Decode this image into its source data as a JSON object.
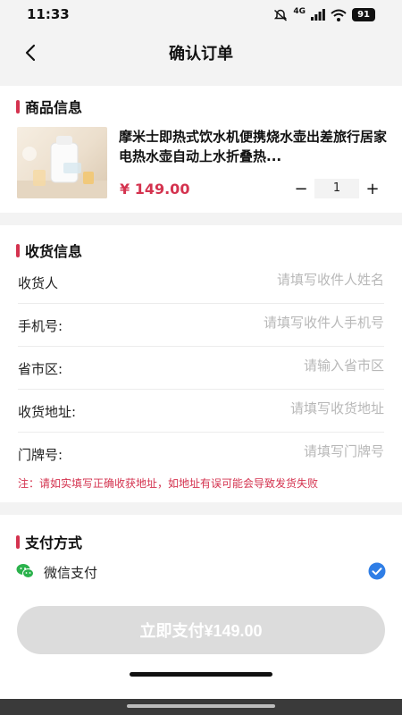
{
  "status_bar": {
    "time": "11:33",
    "network": "4G",
    "battery": "91"
  },
  "nav": {
    "title": "确认订单"
  },
  "product_section": {
    "title": "商品信息",
    "product": {
      "name": "摩米士即热式饮水机便携烧水壶出差旅行居家电热水壶自动上水折叠热...",
      "price": "¥ 149.00",
      "quantity": "1",
      "decrement": "−",
      "increment": "+"
    }
  },
  "shipping_section": {
    "title": "收货信息",
    "fields": [
      {
        "label": "收货人",
        "value": "",
        "placeholder": "请填写收件人姓名"
      },
      {
        "label": "手机号:",
        "value": "",
        "placeholder": "请填写收件人手机号"
      },
      {
        "label": "省市区:",
        "value": "",
        "placeholder": "请输入省市区"
      },
      {
        "label": "收货地址:",
        "value": "",
        "placeholder": "请填写收货地址"
      },
      {
        "label": "门牌号:",
        "value": "",
        "placeholder": "请填写门牌号"
      }
    ],
    "notice": "注：请如实填写正确收获地址，如地址有误可能会导致发货失败"
  },
  "payment_section": {
    "title": "支付方式",
    "method": "微信支付",
    "selected": true
  },
  "pay_button": {
    "label": "立即支付¥149.00"
  },
  "colors": {
    "accent": "#d4334f",
    "wechat_green": "#2bb24c",
    "check_blue": "#2f7ee6",
    "button_disabled": "#dcdcdc"
  },
  "icons": {
    "back": "chevron-left-icon",
    "wechat": "wechat-icon",
    "check": "check-circle-icon",
    "mute": "bell-off-icon",
    "signal": "signal-icon",
    "wifi": "wifi-icon",
    "battery": "battery-icon"
  }
}
